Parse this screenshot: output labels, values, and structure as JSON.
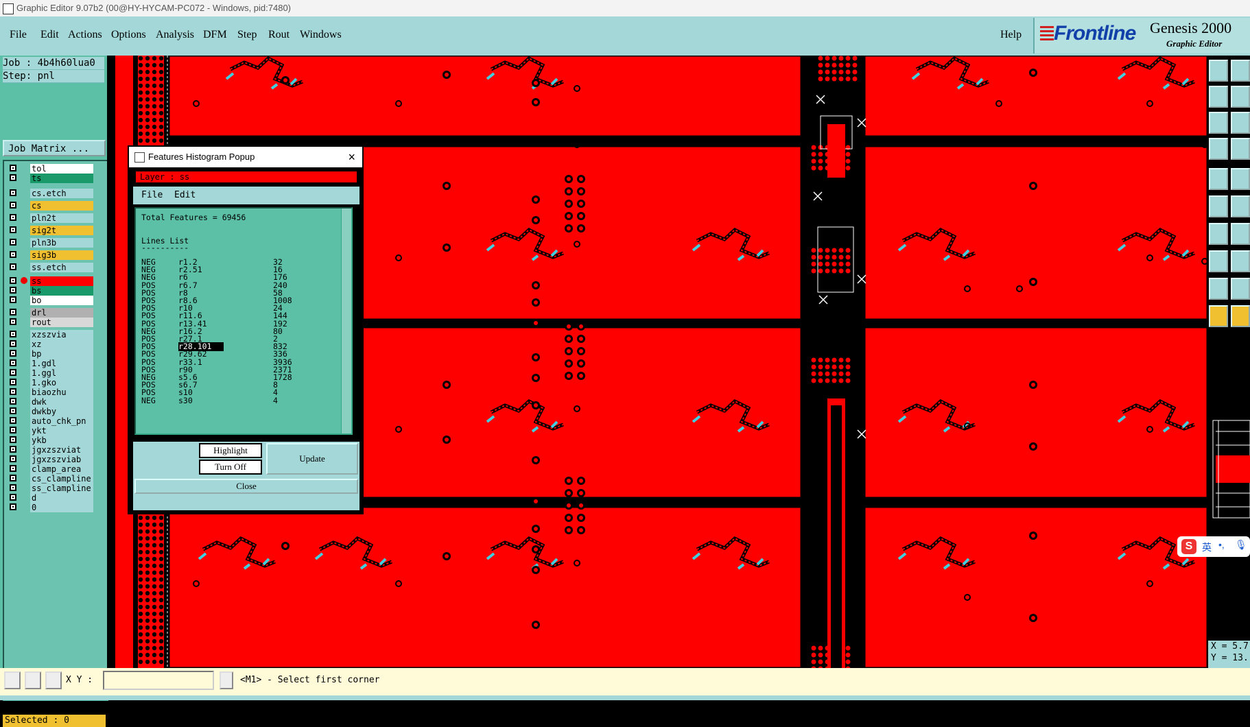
{
  "window": {
    "title": "Graphic Editor 9.07b2 (00@HY-HYCAM-PC072 - Windows, pid:7480)"
  },
  "menus": [
    "File",
    "Edit",
    "Actions",
    "Options",
    "Analysis",
    "DFM",
    "Step",
    "Rout",
    "Windows"
  ],
  "help": "Help",
  "brand": {
    "logo": "Frontline",
    "product": "Genesis 2000",
    "subtitle": "Graphic Editor"
  },
  "job": {
    "job_line": "Job : 4b4h60lua0",
    "step_line": "Step: pnl",
    "matrix_label": "Job Matrix ..."
  },
  "layers": [
    {
      "name": "tol",
      "color": "#ffffff"
    },
    {
      "name": "ts",
      "color": "#1a9a6a"
    },
    {
      "name": "cs.etch",
      "color": "#a4d8d8"
    },
    {
      "name": "cs",
      "color": "#f0c030"
    },
    {
      "name": "pln2t",
      "color": "#a4d8d8"
    },
    {
      "name": "sig2t",
      "color": "#f0c030"
    },
    {
      "name": "pln3b",
      "color": "#a4d8d8"
    },
    {
      "name": "sig3b",
      "color": "#f0c030"
    },
    {
      "name": "ss.etch",
      "color": "#a4d8d8"
    },
    {
      "name": "ss",
      "color": "#ff0000"
    },
    {
      "name": "bs",
      "color": "#1a9a6a"
    },
    {
      "name": "bo",
      "color": "#ffffff"
    },
    {
      "name": "drl",
      "color": "#b0b0b0"
    },
    {
      "name": "rout",
      "color": "#d8d8d8"
    },
    {
      "name": "xzszvia",
      "color": "#a4d8d8"
    },
    {
      "name": "xz",
      "color": "#a4d8d8"
    },
    {
      "name": "bp",
      "color": "#a4d8d8"
    },
    {
      "name": "1.gdl",
      "color": "#a4d8d8"
    },
    {
      "name": "1.ggl",
      "color": "#a4d8d8"
    },
    {
      "name": "1.gko",
      "color": "#a4d8d8"
    },
    {
      "name": "biaozhu",
      "color": "#a4d8d8"
    },
    {
      "name": "dwk",
      "color": "#a4d8d8"
    },
    {
      "name": "dwkby",
      "color": "#a4d8d8"
    },
    {
      "name": "auto_chk_pn",
      "color": "#a4d8d8"
    },
    {
      "name": "ykt",
      "color": "#a4d8d8"
    },
    {
      "name": "ykb",
      "color": "#a4d8d8"
    },
    {
      "name": "jgxzszviat",
      "color": "#a4d8d8"
    },
    {
      "name": "jgxzszviab",
      "color": "#a4d8d8"
    },
    {
      "name": "clamp_area",
      "color": "#a4d8d8"
    },
    {
      "name": "cs_clampline",
      "color": "#a4d8d8"
    },
    {
      "name": "ss_clampline",
      "color": "#a4d8d8"
    },
    {
      "name": "d",
      "color": "#a4d8d8"
    },
    {
      "name": "0",
      "color": "#a4d8d8"
    }
  ],
  "selected": "Selected : 0",
  "popup": {
    "title": "Features Histogram Popup",
    "layer_label": "Layer : ss",
    "menu": [
      "File",
      "Edit"
    ],
    "total": "Total Features = 69456",
    "list_title": "Lines List",
    "separator": "----------",
    "rows": [
      [
        "NEG",
        "r1.2",
        "32"
      ],
      [
        "NEG",
        "r2.51",
        "16"
      ],
      [
        "NEG",
        "r6",
        "176"
      ],
      [
        "POS",
        "r6.7",
        "240"
      ],
      [
        "POS",
        "r8",
        "58"
      ],
      [
        "POS",
        "r8.6",
        "1008"
      ],
      [
        "POS",
        "r10",
        "24"
      ],
      [
        "POS",
        "r11.6",
        "144"
      ],
      [
        "POS",
        "r13.41",
        "192"
      ],
      [
        "NEG",
        "r16.2",
        "80"
      ],
      [
        "POS",
        "r27.1",
        "2"
      ],
      [
        "POS",
        "r28.101",
        "832"
      ],
      [
        "POS",
        "r29.62",
        "336"
      ],
      [
        "POS",
        "r33.1",
        "3936"
      ],
      [
        "POS",
        "r90",
        "2371"
      ],
      [
        "NEG",
        "s5.6",
        "1728"
      ],
      [
        "POS",
        "s6.7",
        "8"
      ],
      [
        "POS",
        "s10",
        "4"
      ],
      [
        "NEG",
        "s30",
        "4"
      ]
    ],
    "highlight_row": 11,
    "buttons": {
      "highlight": "Highlight",
      "turn_off": "Turn Off",
      "update": "Update",
      "close": "Close"
    }
  },
  "bottom": {
    "xy_label": "X Y :",
    "xy_value": "",
    "prompt": "<M1> - Select first corner"
  },
  "readout": {
    "x": "X = 5.7",
    "y": "Y = 13."
  },
  "ime": "英"
}
